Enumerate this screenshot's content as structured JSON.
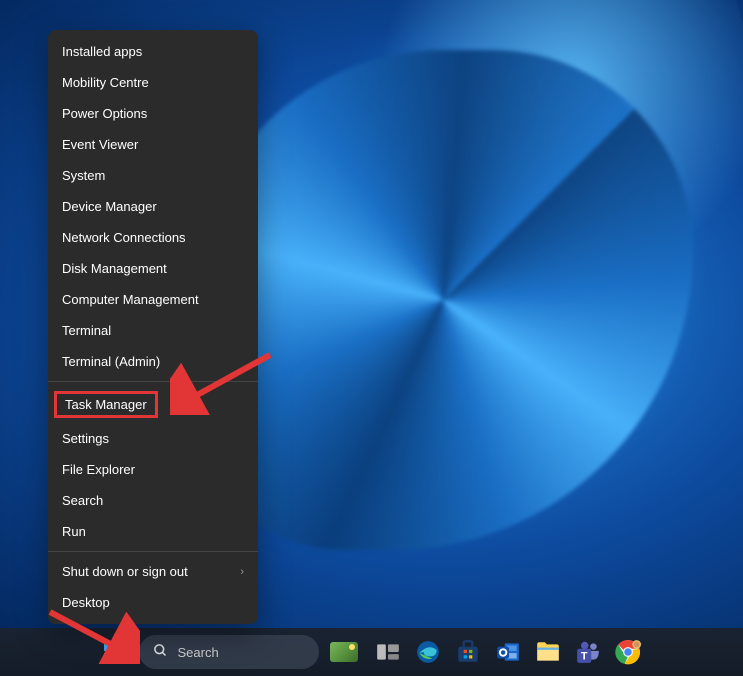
{
  "context_menu": {
    "groups": [
      [
        {
          "label": "Installed apps",
          "name": "menu-item-installed-apps"
        },
        {
          "label": "Mobility Centre",
          "name": "menu-item-mobility-centre"
        },
        {
          "label": "Power Options",
          "name": "menu-item-power-options"
        },
        {
          "label": "Event Viewer",
          "name": "menu-item-event-viewer"
        },
        {
          "label": "System",
          "name": "menu-item-system"
        },
        {
          "label": "Device Manager",
          "name": "menu-item-device-manager"
        },
        {
          "label": "Network Connections",
          "name": "menu-item-network-connections"
        },
        {
          "label": "Disk Management",
          "name": "menu-item-disk-management"
        },
        {
          "label": "Computer Management",
          "name": "menu-item-computer-management"
        },
        {
          "label": "Terminal",
          "name": "menu-item-terminal"
        },
        {
          "label": "Terminal (Admin)",
          "name": "menu-item-terminal-admin"
        }
      ],
      [
        {
          "label": "Task Manager",
          "name": "menu-item-task-manager",
          "highlighted": true
        },
        {
          "label": "Settings",
          "name": "menu-item-settings"
        },
        {
          "label": "File Explorer",
          "name": "menu-item-file-explorer"
        },
        {
          "label": "Search",
          "name": "menu-item-search"
        },
        {
          "label": "Run",
          "name": "menu-item-run"
        }
      ],
      [
        {
          "label": "Shut down or sign out",
          "name": "menu-item-shutdown",
          "submenu": true
        },
        {
          "label": "Desktop",
          "name": "menu-item-desktop"
        }
      ]
    ]
  },
  "taskbar": {
    "search_placeholder": "Search",
    "icons": [
      {
        "name": "task-view-icon",
        "type": "taskview"
      },
      {
        "name": "edge-icon",
        "type": "edge"
      },
      {
        "name": "microsoft-store-icon",
        "type": "store"
      },
      {
        "name": "outlook-icon",
        "type": "outlook"
      },
      {
        "name": "file-explorer-icon",
        "type": "explorer"
      },
      {
        "name": "teams-icon",
        "type": "teams"
      },
      {
        "name": "chrome-icon",
        "type": "chrome"
      }
    ]
  }
}
